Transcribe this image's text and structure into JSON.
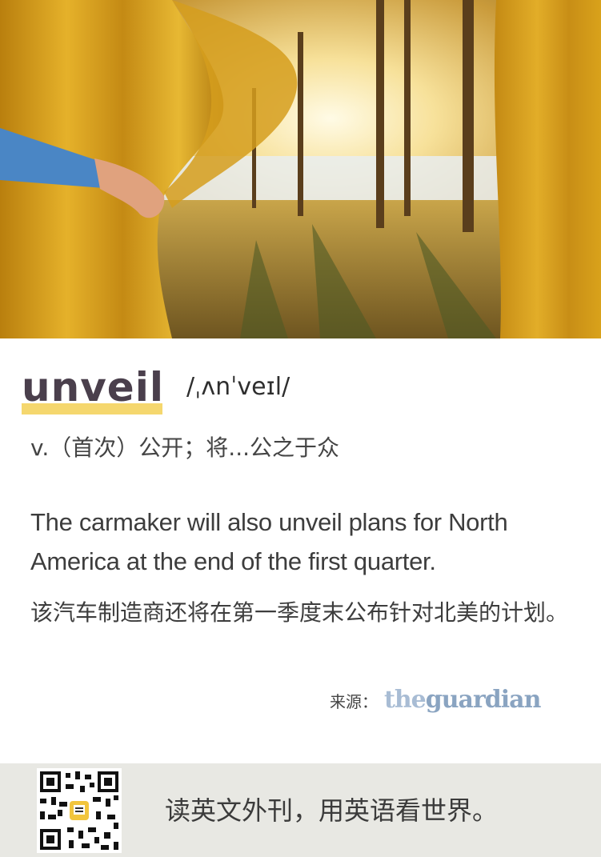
{
  "hero": {
    "alt": "Hand pulling back a yellow curtain to reveal a sunlit forest and lake"
  },
  "word": {
    "text": "unveil",
    "phonetic": "/ˌʌnˈveɪl/"
  },
  "definition": "v.（首次）公开；将...公之于众",
  "example": {
    "en": "The carmaker will also unveil plans for North America at the end of the first quarter.",
    "zh": "该汽车制造商还将在第一季度末公布针对北美的计划。"
  },
  "source": {
    "label": "来源：",
    "logo_the": "the",
    "logo_rest": "guardian"
  },
  "footer": {
    "slogan": "读英文外刊，用英语看世界。"
  },
  "colors": {
    "highlight": "#f5d76e",
    "curtain": "#d9a21b",
    "footer_bg": "#e8e8e3",
    "logo": "#8aa4c1"
  }
}
